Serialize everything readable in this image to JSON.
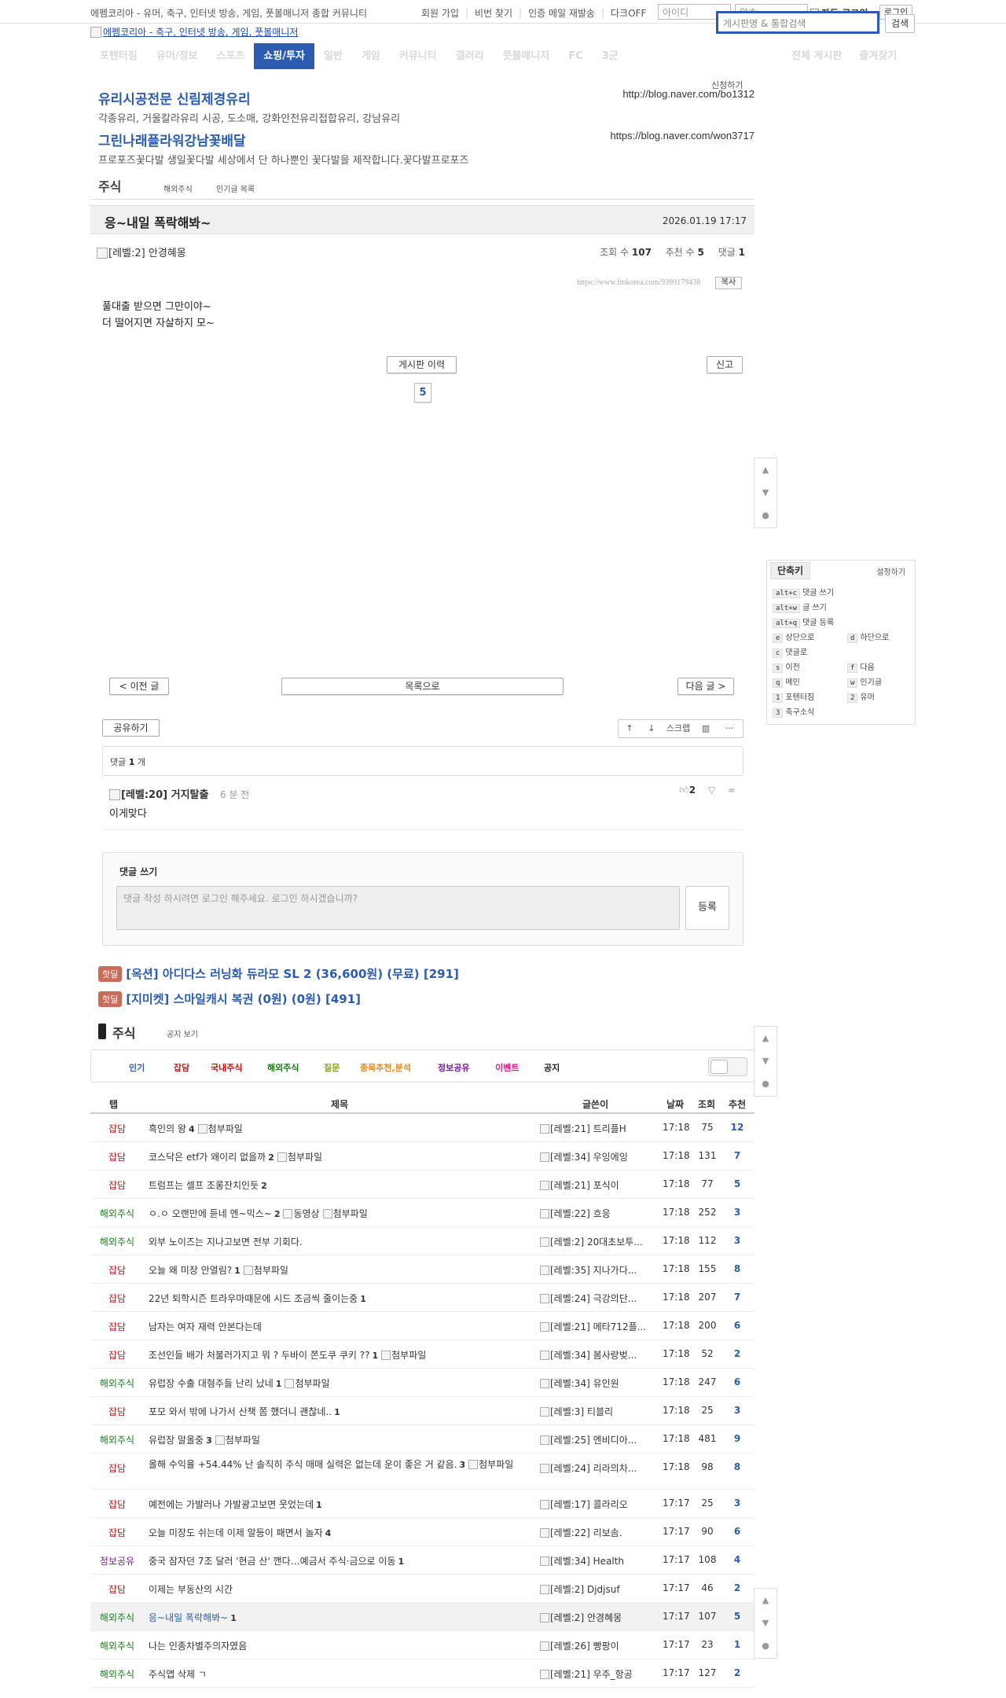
{
  "top": {
    "site_desc": "에펨코리아 - 유머, 축구, 인터넷 방송, 게임, 풋볼매니저 종합 커뮤니티",
    "links": [
      "회원 가입",
      "비번 찾기",
      "인증 메일 재발송",
      "다크OFF"
    ],
    "id_placeholder": "아이디",
    "pw_placeholder": "암호",
    "auto_login": "자동 로그인",
    "login_btn": "로그인",
    "logo_alt": "에펨코리아 - 축구, 인터넷 방송, 게임, 풋볼매니저",
    "search_placeholder": "게시판명 & 통합검색",
    "search_btn": "검색"
  },
  "nav": {
    "items": [
      "포텐터짐",
      "유머/정보",
      "스포츠",
      "쇼핑/투자",
      "일반",
      "게임",
      "커뮤니티",
      "갤러리",
      "풋볼매니저",
      "FC",
      "3군"
    ],
    "active_index": 3,
    "right": [
      "전체 게시판",
      "즐겨찾기"
    ]
  },
  "ads": {
    "apply": "신청하기",
    "items": [
      {
        "title": "유리시공전문 신림제경유리",
        "desc": "각종유리, 거울칼라유리 시공, 도소매, 강화안전유리접합유리, 강남유리",
        "url": "http://blog.naver.com/bo1312"
      },
      {
        "title": "그린나래플라워강남꽃배달",
        "desc": "프로포즈꽃다발 생일꽃다발 세상에서 단 하나뿐인 꽃다발을 제작합니다.꽃다발프로포즈",
        "url": "https://blog.naver.com/won3717"
      }
    ]
  },
  "board": {
    "name": "주식",
    "subs": [
      "해외주식",
      "인기글 목록"
    ]
  },
  "post": {
    "title": "응~내일 폭락해봐~",
    "date": "2026.01.19 17:17",
    "author_level": "[레벨:2]",
    "author": "안경혜몽",
    "views_label": "조회 수",
    "views": "107",
    "votes_label": "추천 수",
    "votes": "5",
    "comments_label": "댓글",
    "comments": "1",
    "permalink": "https://www.fmkorea.com/9399179438",
    "copy_btn": "복사",
    "body": [
      "풀대출 받으면 그만이야~",
      "더 떨어지면 자살하지 모~"
    ],
    "history_btn": "게시판 이력",
    "report_btn": "신고",
    "vote_count": "5"
  },
  "post_nav": {
    "prev": "< 이전 글",
    "list": "목록으로",
    "next": "다음 글 >"
  },
  "share": {
    "btn": "공유하기",
    "scrap": "스크랩"
  },
  "comments": {
    "count_label": "댓글",
    "count": "1",
    "count_unit": "개",
    "items": [
      {
        "level": "[레벨:20]",
        "author": "거지탈출",
        "time": "6 분 전",
        "body": "이게맞다",
        "likes": "2"
      }
    ],
    "write_title": "댓글 쓰기",
    "write_placeholder": "댓글 작성 하시려면 로그인 해주세요. 로그인 하시겠습니까?",
    "submit": "등록"
  },
  "hot": [
    {
      "badge": "핫딜",
      "text": "[옥션] 아디다스 러닝화 듀라모 SL 2 (36,600원) (무료) [291]"
    },
    {
      "badge": "핫딜",
      "text": "[지미켓] 스마일캐시 복권 (0원) (0원) [491]"
    }
  ],
  "list": {
    "title": "주식",
    "notice_toggle": "공지 보기",
    "categories": [
      {
        "label": "인기",
        "color": "#2a5db0"
      },
      {
        "label": "잡담",
        "color": "#b52424"
      },
      {
        "label": "국내주식",
        "color": "#cc1111"
      },
      {
        "label": "해외주식",
        "color": "#1a7a1a"
      },
      {
        "label": "질문",
        "color": "#8a9a2a"
      },
      {
        "label": "종목추천,분석",
        "color": "#e08a2a"
      },
      {
        "label": "정보공유",
        "color": "#7a1a9a"
      },
      {
        "label": "이벤트",
        "color": "#d81a8a"
      },
      {
        "label": "공지",
        "color": "#222222"
      }
    ],
    "columns": [
      "탭",
      "제목",
      "글쓴이",
      "날짜",
      "조회",
      "추천"
    ],
    "rows": [
      {
        "cat": "잡담",
        "cat_color": "#b52424",
        "subject": "흑인의 왕",
        "cc": "4",
        "att": [
          "첨부파일"
        ],
        "level": "[레벨:21]",
        "writer": "트리플H",
        "time": "17:18",
        "views": "75",
        "votes": "12"
      },
      {
        "cat": "잡담",
        "cat_color": "#b52424",
        "subject": "코스닥은 etf가 왜이리 없을까",
        "cc": "2",
        "att": [
          "첨부파일"
        ],
        "level": "[레벨:34]",
        "writer": "우잉에잉",
        "time": "17:18",
        "views": "131",
        "votes": "7"
      },
      {
        "cat": "잡담",
        "cat_color": "#b52424",
        "subject": "트럼프는 셀프 조롱잔치인듯",
        "cc": "2",
        "att": [],
        "level": "[레벨:21]",
        "writer": "포식이",
        "time": "17:18",
        "views": "77",
        "votes": "5"
      },
      {
        "cat": "해외주식",
        "cat_color": "#1a7a1a",
        "subject": "ㅇ.ㅇ 오랜만에 듣네 엔~믹스~",
        "cc": "2",
        "att": [
          "동영상",
          "첨부파일"
        ],
        "level": "[레벨:22]",
        "writer": "흐응",
        "time": "17:18",
        "views": "252",
        "votes": "3"
      },
      {
        "cat": "해외주식",
        "cat_color": "#1a7a1a",
        "subject": "외부 노이즈는 지나고보면 전부 기회다.",
        "cc": "",
        "att": [],
        "level": "[레벨:2]",
        "writer": "20대초보투...",
        "time": "17:18",
        "views": "112",
        "votes": "3"
      },
      {
        "cat": "잡담",
        "cat_color": "#b52424",
        "subject": "오늘 왜 미장 안열림?",
        "cc": "1",
        "att": [
          "첨부파일"
        ],
        "level": "[레벨:35]",
        "writer": "지나가다...",
        "time": "17:18",
        "views": "155",
        "votes": "8"
      },
      {
        "cat": "잡담",
        "cat_color": "#b52424",
        "subject": "22년 퇴학시즌 트라우마때문에 시드 조금씩 줄이는중",
        "cc": "1",
        "att": [],
        "level": "[레벨:24]",
        "writer": "극강의단...",
        "time": "17:18",
        "views": "207",
        "votes": "7"
      },
      {
        "cat": "잡담",
        "cat_color": "#b52424",
        "subject": "남자는 여자 재력 안본다는데",
        "cc": "",
        "att": [],
        "level": "[레벨:21]",
        "writer": "메타712플...",
        "time": "17:18",
        "views": "200",
        "votes": "6"
      },
      {
        "cat": "잡담",
        "cat_color": "#b52424",
        "subject": "조선인들 배가 처불러가지고 뭐 ? 두바이 쫀도쿠 쿠키 ??",
        "cc": "1",
        "att": [
          "첨부파일"
        ],
        "level": "[레벨:34]",
        "writer": "봄사랑벚...",
        "time": "17:18",
        "views": "52",
        "votes": "2"
      },
      {
        "cat": "해외주식",
        "cat_color": "#1a7a1a",
        "subject": "유럽장 수출 대형주들 난리 났네",
        "cc": "1",
        "att": [
          "첨부파일"
        ],
        "level": "[레벨:34]",
        "writer": "유인원",
        "time": "17:18",
        "views": "247",
        "votes": "6"
      },
      {
        "cat": "잡담",
        "cat_color": "#b52424",
        "subject": "포모 와서 밖에 나가서 산책 쫌 했더니 괜찮네..",
        "cc": "1",
        "att": [],
        "level": "[레벨:3]",
        "writer": "티블리",
        "time": "17:18",
        "views": "25",
        "votes": "3"
      },
      {
        "cat": "해외주식",
        "cat_color": "#1a7a1a",
        "subject": "유럽장 말올중",
        "cc": "3",
        "att": [
          "첨부파일"
        ],
        "level": "[레벨:25]",
        "writer": "엔비디아...",
        "time": "17:18",
        "views": "481",
        "votes": "9"
      },
      {
        "cat": "잡담",
        "cat_color": "#b52424",
        "subject": "올해 수익율 +54.44% 난 솔직히 주식 매매 실력은 없는데 운이 좋은 거 같음.",
        "cc": "3",
        "att": [
          "첨부파일"
        ],
        "level": "[레벨:24]",
        "writer": "리라의차...",
        "time": "17:18",
        "views": "98",
        "votes": "8"
      },
      {
        "cat": "잡담",
        "cat_color": "#b52424",
        "subject": "예전에는 가발러나 가발광고보면 웃었는데",
        "cc": "1",
        "att": [],
        "level": "[레벨:17]",
        "writer": "콜라리오",
        "time": "17:17",
        "views": "25",
        "votes": "3"
      },
      {
        "cat": "잡담",
        "cat_color": "#b52424",
        "subject": "오늘 미장도 쉬는데 이제 알등이 패면서 놀자",
        "cc": "4",
        "att": [],
        "level": "[레벨:22]",
        "writer": "리보솜.",
        "time": "17:17",
        "views": "90",
        "votes": "6"
      },
      {
        "cat": "정보공유",
        "cat_color": "#7a1a9a",
        "subject": "중국 잠자던 7조 달러 '현금 산' 깬다…예금서 주식·금으로 이동",
        "cc": "1",
        "att": [],
        "level": "[레벨:34]",
        "writer": "Health",
        "time": "17:17",
        "views": "108",
        "votes": "4"
      },
      {
        "cat": "잡담",
        "cat_color": "#b52424",
        "subject": "이제는 부동산의 시간",
        "cc": "",
        "att": [],
        "level": "[레벨:2]",
        "writer": "Djdjsuf",
        "time": "17:17",
        "views": "46",
        "votes": "2"
      },
      {
        "cat": "해외주식",
        "cat_color": "#1a7a1a",
        "subject": "응~내일 폭락해봐~",
        "cc": "1",
        "att": [],
        "level": "[레벨:2]",
        "writer": "안경혜몽",
        "time": "17:17",
        "views": "107",
        "votes": "5",
        "highlight": true
      },
      {
        "cat": "해외주식",
        "cat_color": "#1a7a1a",
        "subject": "나는 인종차별주의자였음",
        "cc": "",
        "att": [],
        "level": "[레벨:26]",
        "writer": "빵팡이",
        "time": "17:17",
        "views": "23",
        "votes": "1"
      },
      {
        "cat": "해외주식",
        "cat_color": "#1a7a1a",
        "subject": "주식앱 삭제 ㄱ",
        "cc": "",
        "att": [],
        "level": "[레벨:21]",
        "writer": "우주_항공",
        "time": "17:17",
        "views": "127",
        "votes": "2"
      }
    ]
  },
  "shortcuts": {
    "title": "단축키",
    "setting": "설정하기",
    "rows": [
      {
        "key": "alt+c",
        "label": "댓글 쓰기"
      },
      {
        "key": "alt+w",
        "label": "글 쓰기"
      },
      {
        "key": "alt+q",
        "label": "댓글 등록"
      }
    ],
    "pairs": [
      [
        {
          "key": "e",
          "label": "상단으로"
        },
        {
          "key": "d",
          "label": "하단으로"
        }
      ],
      [
        {
          "key": "c",
          "label": "댓글로"
        },
        null
      ],
      [
        {
          "key": "s",
          "label": "이전"
        },
        {
          "key": "f",
          "label": "다음"
        }
      ],
      [
        {
          "key": "q",
          "label": "메인"
        },
        {
          "key": "w",
          "label": "인기글"
        }
      ],
      [
        {
          "key": "1",
          "label": "포텐터짐"
        },
        {
          "key": "2",
          "label": "유머"
        }
      ],
      [
        {
          "key": "3",
          "label": "축구소식"
        },
        null
      ]
    ]
  },
  "colors": {
    "accent": "#2a5db0",
    "hot_badge": "#c96d5a"
  }
}
